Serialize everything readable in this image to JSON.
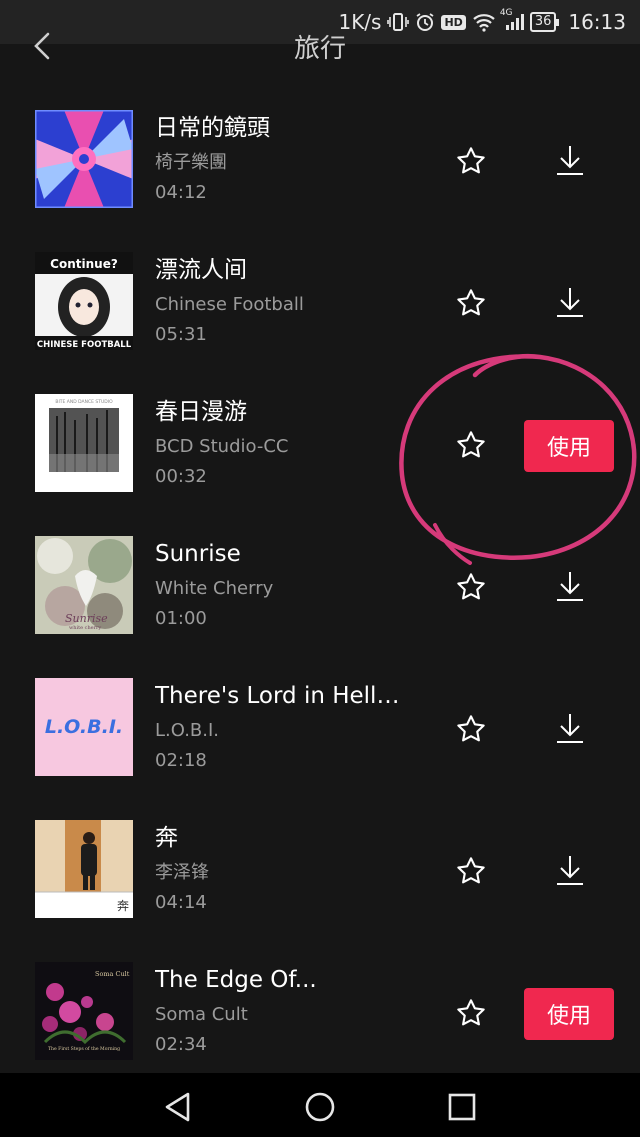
{
  "status_bar": {
    "net_speed": "1K/s",
    "signal_label": "4G",
    "hd_label": "HD",
    "battery": "36",
    "time": "16:13",
    "icons": [
      "vibrate-icon",
      "alarm-icon",
      "hd-icon",
      "wifi-icon",
      "signal-icon",
      "battery-icon"
    ]
  },
  "header": {
    "title": "旅行",
    "back_icon": "back-chevron-icon"
  },
  "tracks": [
    {
      "title": "日常的鏡頭",
      "artist": "椅子樂團",
      "duration": "04:12",
      "action": "download"
    },
    {
      "title": "漂流人间",
      "artist": "Chinese Football",
      "duration": "05:31",
      "action": "download",
      "cover_text": [
        "Continue?",
        "CHINESE FOOTBALL"
      ]
    },
    {
      "title": "春日漫游",
      "artist": "BCD Studio-CC",
      "duration": "00:32",
      "action": "use",
      "cover_text": [
        "BITE AND DANCE STUDIO"
      ]
    },
    {
      "title": "Sunrise",
      "artist": "White Cherry",
      "duration": "01:00",
      "action": "download",
      "cover_text": [
        "Sunrise",
        "white cherry"
      ]
    },
    {
      "title": "There's Lord in Hello,...",
      "artist": "L.O.B.I.",
      "duration": "02:18",
      "action": "download",
      "cover_text": [
        "L.O.B.I."
      ]
    },
    {
      "title": "奔",
      "artist": "李泽锋",
      "duration": "04:14",
      "action": "download",
      "cover_text": [
        "奔"
      ]
    },
    {
      "title": "The Edge Of...",
      "artist": "Soma Cult",
      "duration": "02:34",
      "action": "use",
      "cover_text": [
        "Soma Cult",
        "The First Steps of the Morning"
      ]
    }
  ],
  "use_label": "使用",
  "colors": {
    "background": "#161616",
    "accent": "#f0284f",
    "annotation": "#d63a7a",
    "text_primary": "#ffffff",
    "text_secondary": "#9b9b9b"
  },
  "nav_bar": {
    "icons": [
      "back-triangle-icon",
      "home-circle-icon",
      "recents-square-icon"
    ]
  }
}
